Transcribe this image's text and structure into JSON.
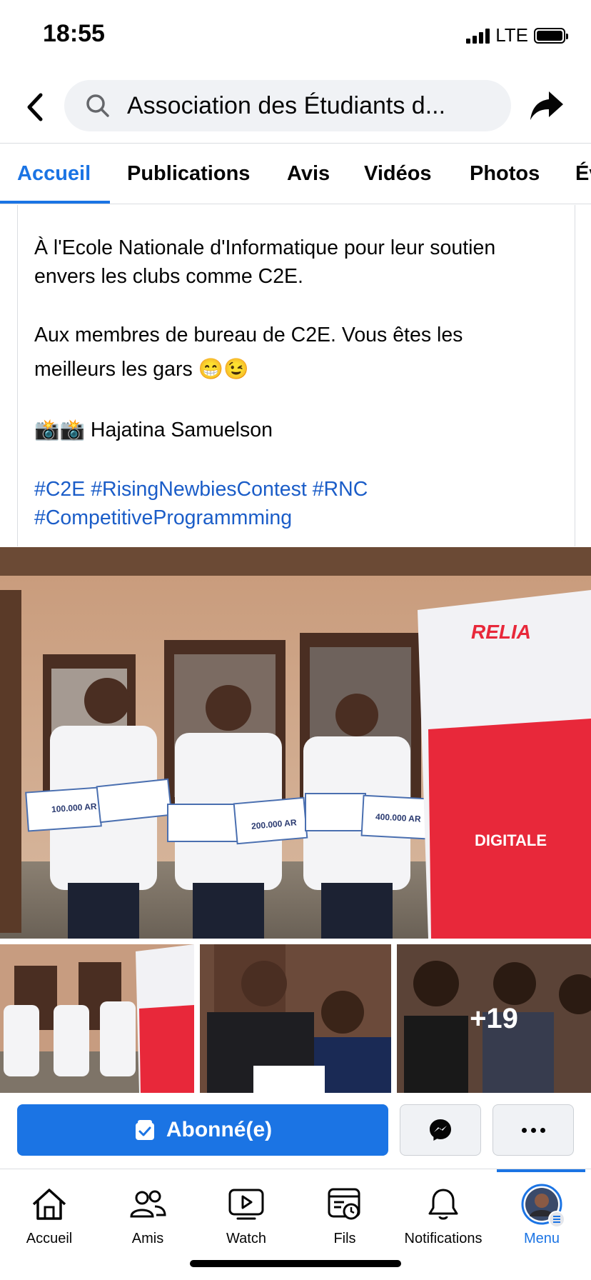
{
  "status_bar": {
    "time": "18:55",
    "network": "LTE"
  },
  "header": {
    "search_text": "Association des Étudiants d..."
  },
  "tabs": [
    {
      "label": "Accueil",
      "active": true
    },
    {
      "label": "Publications"
    },
    {
      "label": "Avis"
    },
    {
      "label": "Vidéos"
    },
    {
      "label": "Photos"
    },
    {
      "label": "Év"
    }
  ],
  "post": {
    "para1": "À l'Ecole Nationale d'Informatique pour leur soutien envers les clubs comme C2E.",
    "para2": "Aux membres de bureau de C2E. Vous êtes les meilleurs les gars 😁😉",
    "photographer": "📸📸 Hajatina Samuelson",
    "hashtags_line1": "#C2E #RisingNewbiesContest #RNC",
    "hashtags_line2": "#CompetitiveProgrammming"
  },
  "photos": {
    "banner_brand": "RELIA",
    "banner_headline": "DIGITALE",
    "certificates": [
      "100.000 AR",
      "200.000 AR",
      "400.000 AR"
    ],
    "more_count": "+19"
  },
  "actions": {
    "subscribe_label": "Abonné(e)"
  },
  "bottom_nav": [
    {
      "label": "Accueil",
      "icon": "home-icon"
    },
    {
      "label": "Amis",
      "icon": "friends-icon"
    },
    {
      "label": "Watch",
      "icon": "watch-icon"
    },
    {
      "label": "Fils",
      "icon": "feeds-icon"
    },
    {
      "label": "Notifications",
      "icon": "bell-icon"
    },
    {
      "label": "Menu",
      "icon": "profile-avatar",
      "active": true
    }
  ],
  "colors": {
    "accent": "#1b74e4",
    "hashtag": "#1b5dc8",
    "banner_red": "#e8283a"
  }
}
